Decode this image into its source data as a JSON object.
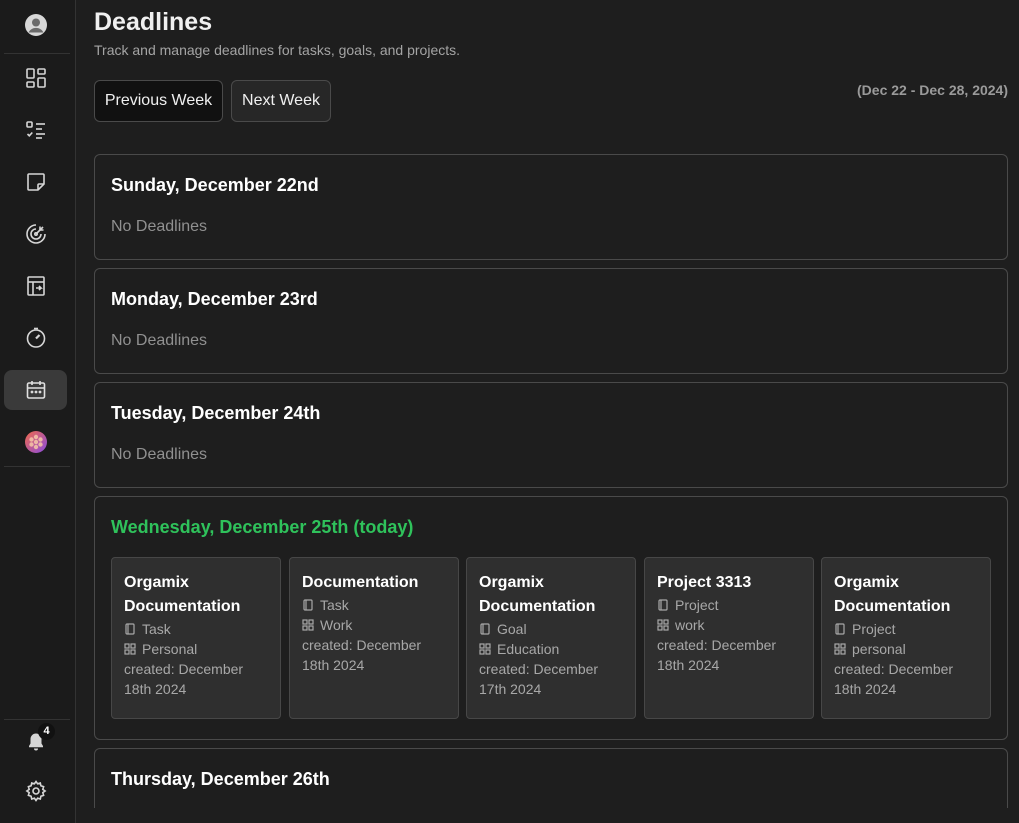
{
  "sidebar": {
    "items": [
      {
        "icon": "avatar-icon"
      },
      {
        "icon": "dashboard-icon"
      },
      {
        "icon": "tasks-icon"
      },
      {
        "icon": "notes-icon"
      },
      {
        "icon": "goals-icon"
      },
      {
        "icon": "projects-icon"
      },
      {
        "icon": "timer-icon"
      },
      {
        "icon": "calendar-icon",
        "active": true
      },
      {
        "icon": "app-logo-icon"
      }
    ],
    "notifications_count": "4"
  },
  "header": {
    "title": "Deadlines",
    "subtitle": "Track and manage deadlines for tasks, goals, and projects.",
    "prev_label": "Previous Week",
    "next_label": "Next Week",
    "range": "(Dec 22 - Dec 28, 2024)"
  },
  "days": [
    {
      "title": "Sunday, December 22nd",
      "empty": "No Deadlines"
    },
    {
      "title": "Monday, December 23rd",
      "empty": "No Deadlines"
    },
    {
      "title": "Tuesday, December 24th",
      "empty": "No Deadlines"
    },
    {
      "title": "Wednesday, December 25th (today)",
      "items": [
        {
          "title": "Orgamix Documentation",
          "type": "Task",
          "category": "Personal",
          "created": "created: December 18th 2024"
        },
        {
          "title": "Documentation",
          "type": "Task",
          "category": "Work",
          "created": "created: December 18th 2024"
        },
        {
          "title": "Orgamix Documentation",
          "type": "Goal",
          "category": "Education",
          "created": "created: December 17th 2024"
        },
        {
          "title": "Project 3313",
          "type": "Project",
          "category": "work",
          "created": "created: December 18th 2024"
        },
        {
          "title": "Orgamix Documentation",
          "type": "Project",
          "category": "personal",
          "created": "created: December 18th 2024"
        }
      ]
    },
    {
      "title": "Thursday, December 26th"
    }
  ],
  "colors": {
    "today": "#2fc25b",
    "background": "#1e1e1e",
    "sidebar": "#1b1b1b"
  }
}
